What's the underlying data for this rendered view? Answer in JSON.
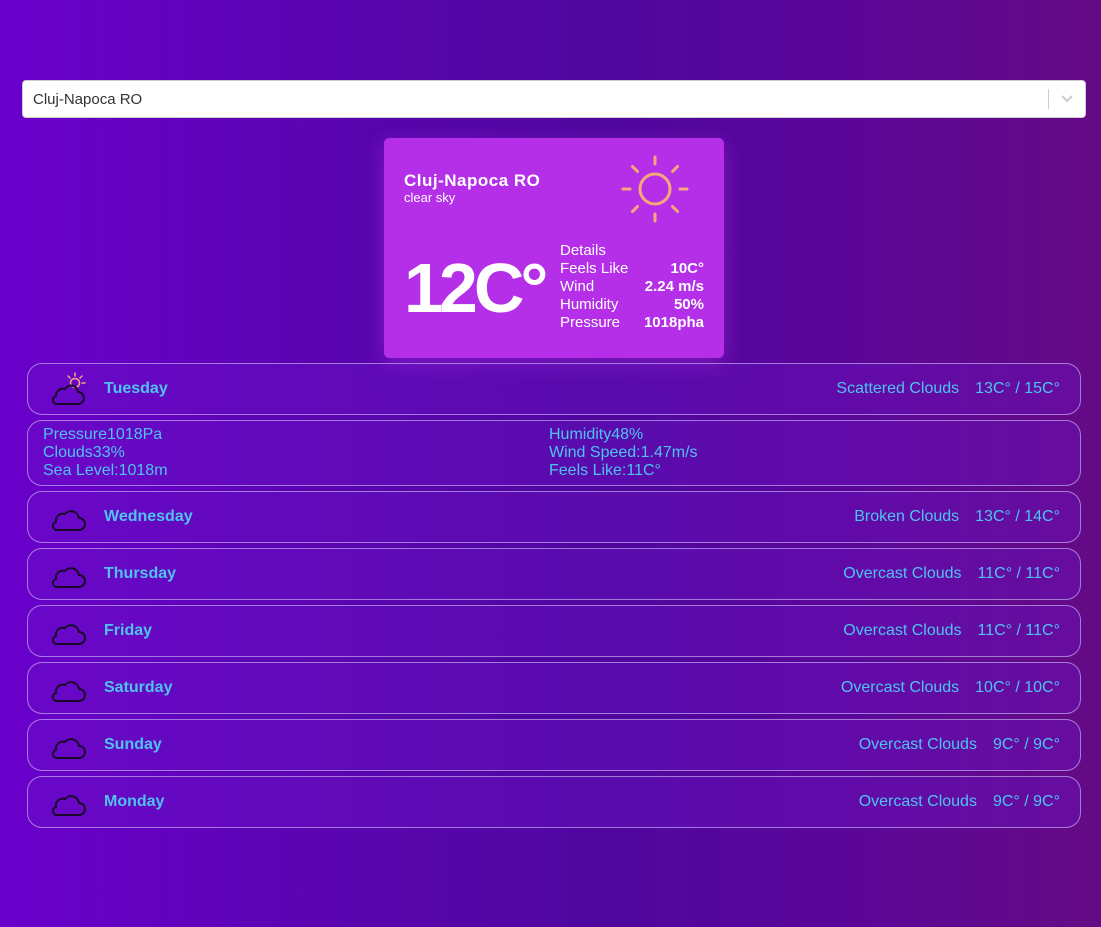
{
  "search": {
    "value": "Cluj-Napoca RO"
  },
  "current": {
    "city": "Cluj-Napoca RO",
    "description": "clear sky",
    "temperature": "12C°",
    "icon": "sun-icon",
    "details_title": "Details",
    "details": [
      {
        "label": "Feels Like",
        "value": "10C°"
      },
      {
        "label": "Wind",
        "value": "2.24 m/s"
      },
      {
        "label": "Humidity",
        "value": "50%"
      },
      {
        "label": "Pressure",
        "value": "1018pha"
      }
    ]
  },
  "forecast": [
    {
      "day": "Tuesday",
      "description": "Scattered Clouds",
      "temps": "13C° / 15C°",
      "icon": "partly-cloudy-icon"
    },
    {
      "day": "Wednesday",
      "description": "Broken Clouds",
      "temps": "13C° / 14C°",
      "icon": "cloud-icon"
    },
    {
      "day": "Thursday",
      "description": "Overcast Clouds",
      "temps": "11C° / 11C°",
      "icon": "cloud-icon"
    },
    {
      "day": "Friday",
      "description": "Overcast Clouds",
      "temps": "11C° / 11C°",
      "icon": "cloud-icon"
    },
    {
      "day": "Saturday",
      "description": "Overcast Clouds",
      "temps": "10C° / 10C°",
      "icon": "cloud-icon"
    },
    {
      "day": "Sunday",
      "description": "Overcast Clouds",
      "temps": "9C° / 9C°",
      "icon": "cloud-icon"
    },
    {
      "day": "Monday",
      "description": "Overcast Clouds",
      "temps": "9C° / 9C°",
      "icon": "cloud-icon"
    }
  ],
  "expanded_details": {
    "left": [
      "Pressure1018Pa",
      "Clouds33%",
      "Sea Level:1018m"
    ],
    "right": [
      "Humidity48%",
      "Wind Speed:1.47m/s",
      "Feels Like:11C°"
    ]
  },
  "colors": {
    "accent_text": "#4ec3f0",
    "card_bg": "#b52ee8",
    "sun_stroke": "#f7a87a"
  }
}
